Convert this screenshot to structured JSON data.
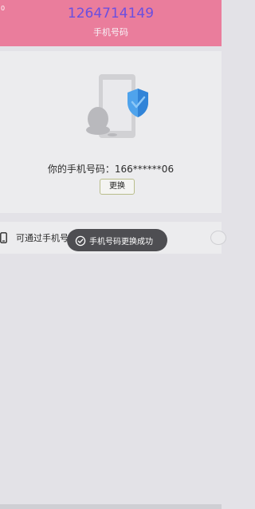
{
  "status_bar": {
    "left_text": "0"
  },
  "header": {
    "account": "1264714149",
    "title": "手机号码",
    "background_color": "#ea7d9c",
    "account_color": "#6b4fe0"
  },
  "phone_card": {
    "illustration_icon": "phone-shield-penguin-icon",
    "phone_label": "你的手机号码：166******06",
    "change_button_label": "更换"
  },
  "find_me_row": {
    "icon": "phone-icon",
    "label": "可通过手机号找到我"
  },
  "toast": {
    "icon": "check-circle-icon",
    "message": "手机号码更换成功"
  }
}
